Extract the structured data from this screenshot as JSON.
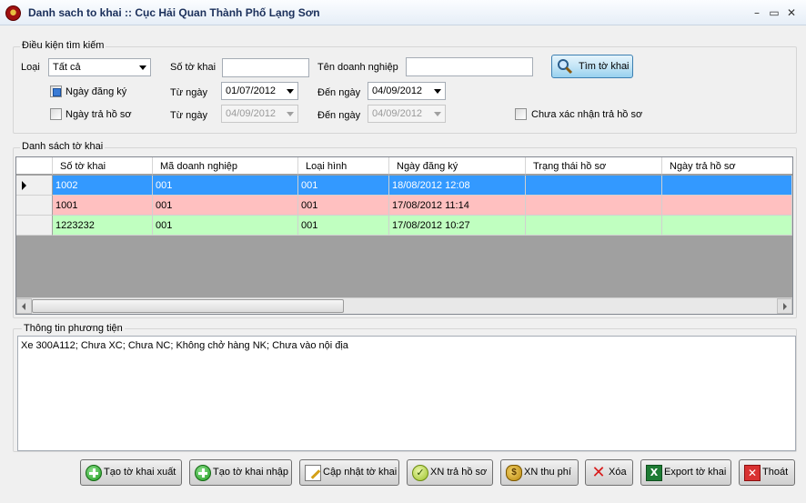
{
  "window": {
    "title": "Danh sach to khai :: Cục Hải Quan Thành Phố Lạng Sơn",
    "minimize": "–",
    "maximize": "▭",
    "close": "✕"
  },
  "search": {
    "group_label": "Điều kiện tìm kiếm",
    "loai_label": "Loại",
    "loai_value": "Tất cả",
    "so_to_khai_label": "Số tờ khai",
    "so_to_khai_value": "",
    "ten_dn_label": "Tên doanh nghiệp",
    "ten_dn_value": "",
    "search_button": "Tìm tờ khai",
    "ngay_dang_ky": {
      "label": "Ngày đăng ký",
      "checked": true,
      "tu_label": "Từ ngày",
      "tu_value": "01/07/2012",
      "den_label": "Đến ngày",
      "den_value": "04/09/2012"
    },
    "ngay_tra": {
      "label": "Ngày trả hồ sơ",
      "checked": false,
      "tu_label": "Từ ngày",
      "tu_value": "04/09/2012",
      "den_label": "Đến ngày",
      "den_value": "04/09/2012"
    },
    "chua_xac_nhan_label": "Chưa xác nhận trả hồ sơ"
  },
  "list": {
    "group_label": "Danh sách tờ khai",
    "columns": [
      "Số tờ khai",
      "Mã doanh nghiệp",
      "Loại hình",
      "Ngày đăng ký",
      "Trạng thái hồ sơ",
      "Ngày trả hồ sơ"
    ],
    "rows": [
      {
        "so": "1002",
        "ma": "001",
        "loai": "001",
        "ngay": "18/08/2012 12:08",
        "trang_thai": "",
        "ngay_tra": "",
        "color": "#3399ff",
        "selected": true
      },
      {
        "so": "1001",
        "ma": "001",
        "loai": "001",
        "ngay": "17/08/2012 11:14",
        "trang_thai": "",
        "ngay_tra": "",
        "color": "#ffc0c0"
      },
      {
        "so": "1223232",
        "ma": "001",
        "loai": "001",
        "ngay": "17/08/2012 10:27",
        "trang_thai": "",
        "ngay_tra": "",
        "color": "#c0ffc0"
      }
    ]
  },
  "vehicle": {
    "group_label": "Thông tin phương tiện",
    "text": "Xe 300A112;  Chưa XC; Chưa NC; Không chở hàng NK; Chưa vào nội địa"
  },
  "buttons": [
    {
      "name": "tao-to-khai-xuat-button",
      "label": "Tạo tờ khai xuất",
      "icon": "plus-icon"
    },
    {
      "name": "tao-to-khai-nhap-button",
      "label": "Tạo tờ khai nhập",
      "icon": "plus-icon"
    },
    {
      "name": "cap-nhat-to-khai-button",
      "label": "Cập nhật tờ khai",
      "icon": "edit-icon"
    },
    {
      "name": "xn-tra-ho-so-button",
      "label": "XN trả hồ sơ",
      "icon": "check-icon"
    },
    {
      "name": "xn-thu-phi-button",
      "label": "XN thu phí",
      "icon": "money-bag-icon"
    },
    {
      "name": "xoa-button",
      "label": "Xóa",
      "icon": "delete-icon"
    },
    {
      "name": "export-to-khai-button",
      "label": "Export tờ khai",
      "icon": "excel-icon"
    },
    {
      "name": "thoat-button",
      "label": "Thoát",
      "icon": "exit-icon"
    }
  ],
  "colors": {
    "selected_row": "#3399ff",
    "pink_row": "#ffc0c0",
    "green_row": "#c0ffc0",
    "grid_bg": "#a0a0a0"
  }
}
